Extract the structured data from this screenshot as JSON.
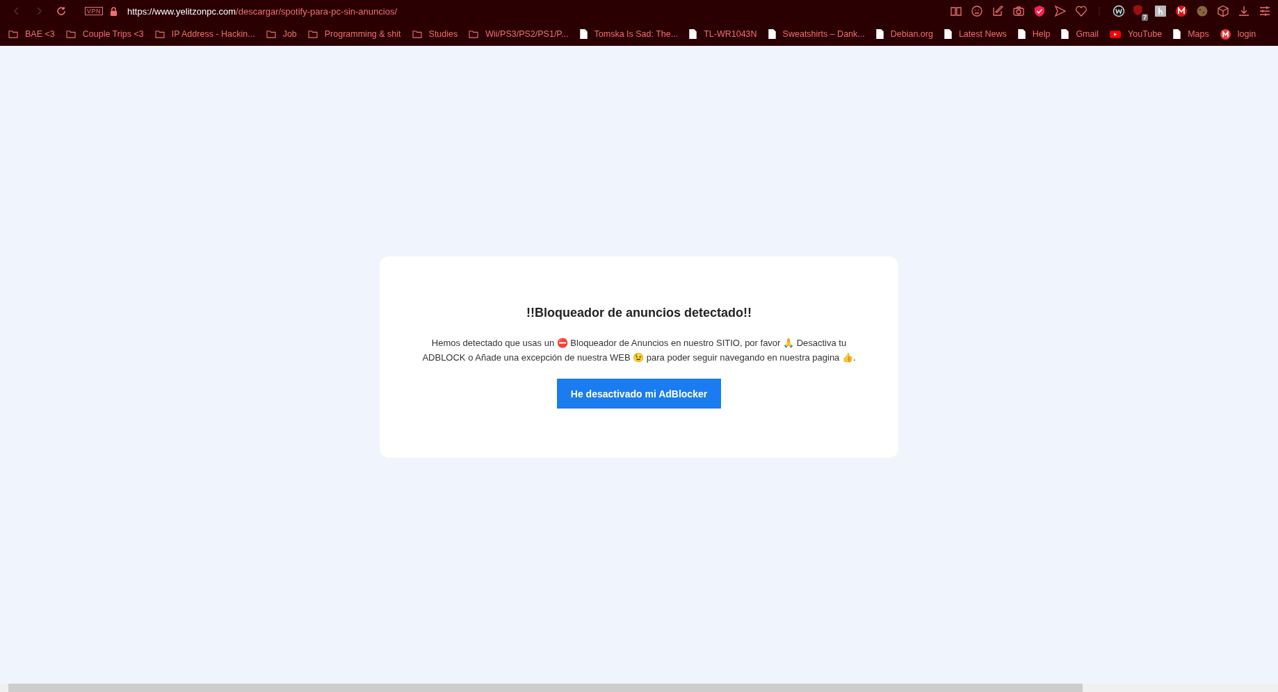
{
  "browser": {
    "vpn_label": "VPN",
    "url_host": "https://www.yelitzonpc.com",
    "url_path": "/descargar/spotify-para-pc-sin-anuncios/",
    "extensions": [
      {
        "kind": "reader"
      },
      {
        "kind": "face"
      },
      {
        "kind": "edit"
      },
      {
        "kind": "camera"
      },
      {
        "kind": "shield"
      },
      {
        "kind": "send"
      },
      {
        "kind": "heart"
      },
      {
        "kind": "sep"
      },
      {
        "kind": "w"
      },
      {
        "kind": "ublock",
        "badge": "7"
      },
      {
        "kind": "h"
      },
      {
        "kind": "mega"
      },
      {
        "kind": "cookie"
      },
      {
        "kind": "cube"
      },
      {
        "kind": "download"
      },
      {
        "kind": "sliders"
      }
    ]
  },
  "bookmarks": [
    {
      "kind": "folder",
      "label": "BAE <3"
    },
    {
      "kind": "folder",
      "label": "Couple Trips <3"
    },
    {
      "kind": "folder",
      "label": "IP Address - Hackin..."
    },
    {
      "kind": "folder",
      "label": "Job"
    },
    {
      "kind": "folder",
      "label": "Programming & shit"
    },
    {
      "kind": "folder",
      "label": "Studies"
    },
    {
      "kind": "folder",
      "label": "Wii/PS3/PS2/PS1/P..."
    },
    {
      "kind": "page",
      "label": "Tomska Is Sad: The..."
    },
    {
      "kind": "page",
      "label": "TL-WR1043N"
    },
    {
      "kind": "page",
      "label": "Sweatshirts – Dank..."
    },
    {
      "kind": "page",
      "label": "Debian.org"
    },
    {
      "kind": "page",
      "label": "Latest News"
    },
    {
      "kind": "page",
      "label": "Help"
    },
    {
      "kind": "page",
      "label": "Gmail"
    },
    {
      "kind": "video",
      "label": "YouTube"
    },
    {
      "kind": "page",
      "label": "Maps"
    },
    {
      "kind": "mega",
      "label": "login"
    }
  ],
  "dialog": {
    "title": "!!Bloqueador de anuncios detectado!!",
    "message": "Hemos detectado que usas un ⛔ Bloqueador de Anuncios en nuestro SITIO, por favor 🙏 Desactiva tu ADBLOCK o Añade una excepción de nuestra WEB 😉 para poder seguir navegando en nuestra pagina 👍.",
    "button": "He desactivado mi AdBlocker"
  }
}
